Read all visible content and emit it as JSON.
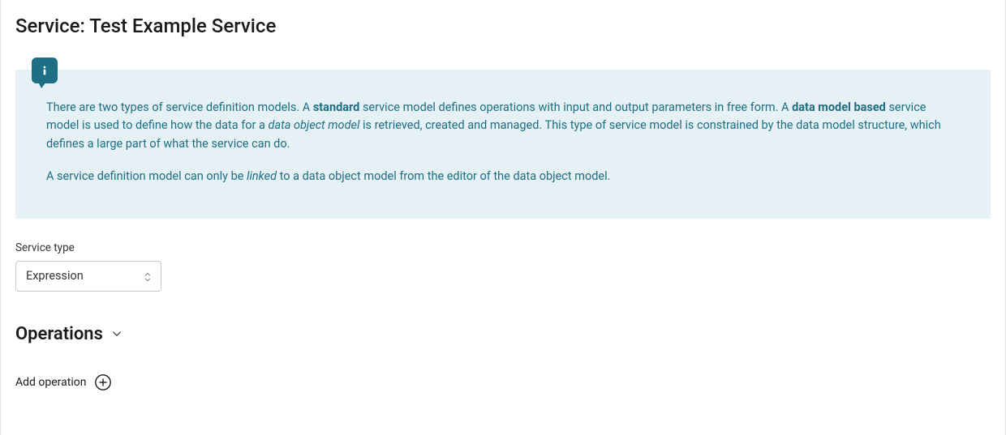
{
  "header": {
    "title_prefix": "Service: ",
    "title_name": "Test Example Service"
  },
  "info": {
    "p1_a": "There are two types of service definition models. A ",
    "p1_b_bold": "standard",
    "p1_c": " service model defines operations with input and output parameters in free form. A ",
    "p1_d_bold": "data model based",
    "p1_e": " service model is used to define how the data for a ",
    "p1_f_italic": "data object model",
    "p1_g": " is retrieved, created and managed. This type of service model is constrained by the data model structure, which defines a large part of what the service can do.",
    "p2_a": "A service definition model can only be ",
    "p2_b_italic": "linked",
    "p2_c": " to a data object model from the editor of the data object model."
  },
  "service_type": {
    "label": "Service type",
    "value": "Expression"
  },
  "operations": {
    "heading": "Operations",
    "add_label": "Add operation"
  }
}
